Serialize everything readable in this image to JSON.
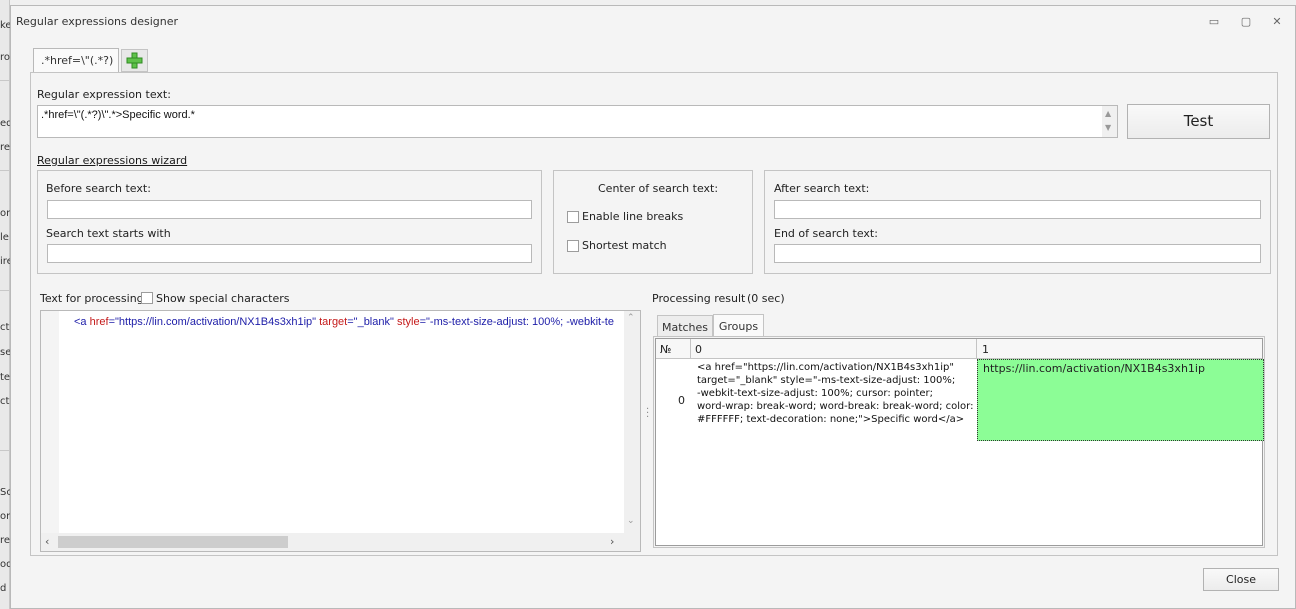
{
  "background": {
    "left_fragments": [
      "ke",
      "ro",
      "ed",
      "re",
      "on",
      "le",
      "ire",
      "ct",
      "se",
      "te",
      "ct",
      "Sc",
      "ord",
      "re",
      "od",
      "d"
    ]
  },
  "dialog": {
    "title": "Regular expressions designer",
    "controls": {
      "minimize": "▭",
      "maximize": "▢",
      "close": "✕"
    },
    "tab": {
      "label": ".*href=\\\"(.*?)"
    },
    "add_tab_icon": "plus-icon"
  },
  "regex": {
    "label": "Regular expression text:",
    "value": ".*href=\\\"(.*?)\\\".*>Specific word.*",
    "test_button": "Test"
  },
  "wizard": {
    "link": "Regular expressions wizard",
    "before_label": "Before search text:",
    "before_value": "",
    "starts_label": "Search text starts with",
    "starts_value": "",
    "center_label": "Center of search text:",
    "line_breaks_label": "Enable line breaks",
    "line_breaks_checked": false,
    "shortest_label": "Shortest match",
    "shortest_checked": false,
    "after_label": "After search text:",
    "after_value": "",
    "end_label": "End of search text:",
    "end_value": ""
  },
  "processing": {
    "label": "Text for processing",
    "show_special_label": "Show special characters",
    "show_special_checked": false,
    "code_tag_open": "<a ",
    "code_attr1": "href",
    "code_eq1": "=",
    "code_val1": "\"https://lin.com/activation/NX1B4s3xh1ip\"",
    "code_attr2": " target",
    "code_eq2": "=",
    "code_val2": "\"_blank\"",
    "code_attr3": " style",
    "code_eq3": "=",
    "code_val3": "\"-ms-text-size-adjust: 100%; -webkit-te"
  },
  "result": {
    "label": "Processing result",
    "time": "(0 sec)",
    "tabs": [
      "Matches",
      "Groups"
    ],
    "active_tab": "Groups",
    "columns": [
      "№",
      "0",
      "1"
    ],
    "rows": [
      {
        "index": "0",
        "group0": "<a href=\"https://lin.com/activation/NX1B4s3xh1ip\"\ntarget=\"_blank\" style=\"-ms-text-size-adjust: 100%;\n-webkit-text-size-adjust: 100%; cursor: pointer;\nword-wrap: break-word; word-break: break-word; color:\n#FFFFFF; text-decoration: none;\">Specific word</a>",
        "group1": "https://lin.com/activation/NX1B4s3xh1ip"
      }
    ],
    "highlight_color": "#8cfd96"
  },
  "footer": {
    "close_button": "Close"
  }
}
